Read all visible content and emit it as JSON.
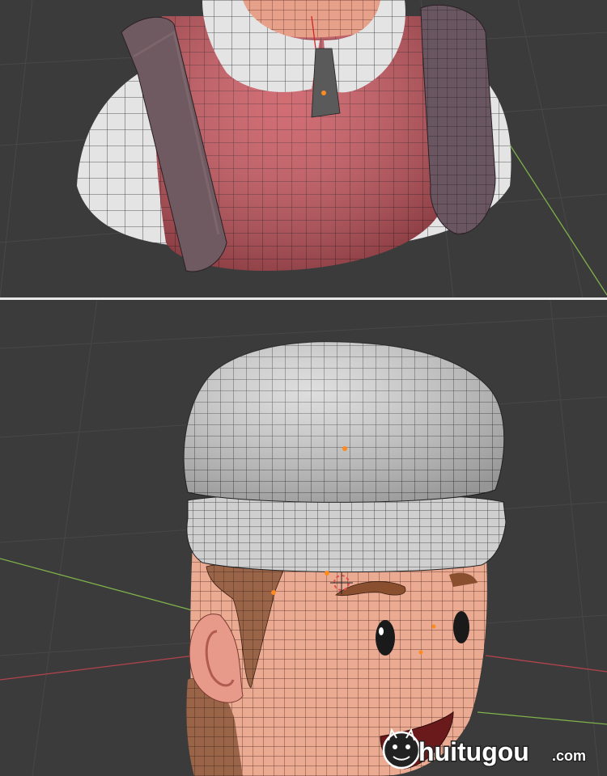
{
  "watermark": {
    "brand": "huitugou",
    "domain": ".com",
    "logo_icon": "cat-face-icon"
  },
  "colors": {
    "viewport_bg": "#3b3b3b",
    "grid_line": "#4a4a4a",
    "axis_x": "#b4434e",
    "axis_y": "#7fb04a",
    "skin": "#e9a48a",
    "shirt_red": "#c9545c",
    "collar": "#e6e6e6",
    "strap": "#6e5a60",
    "hat": "#d4d4d4",
    "hair": "#8a4f2e"
  }
}
